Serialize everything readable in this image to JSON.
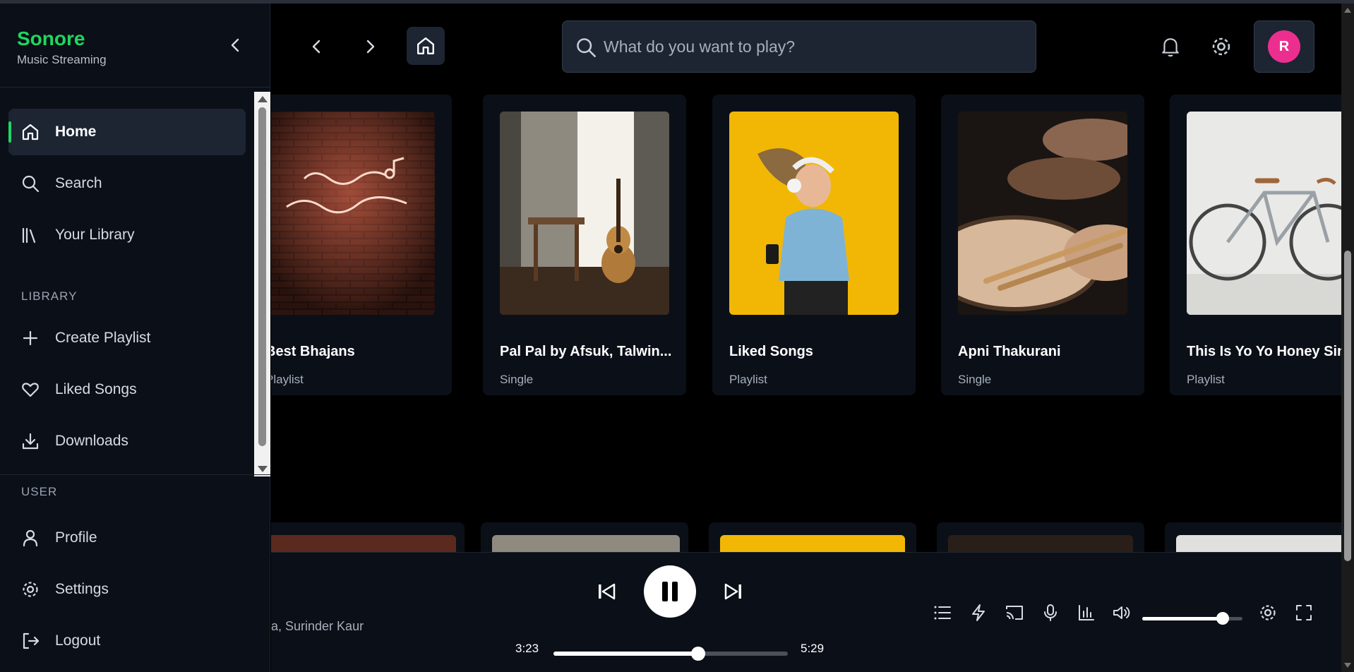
{
  "brand": {
    "name": "Sonore",
    "subtitle": "Music Streaming"
  },
  "sidebar": {
    "main_items": [
      {
        "label": "Home",
        "icon": "home-icon",
        "active": true
      },
      {
        "label": "Search",
        "icon": "search-icon"
      },
      {
        "label": "Your Library",
        "icon": "library-icon"
      }
    ],
    "library_section": "LIBRARY",
    "library_items": [
      {
        "label": "Create Playlist",
        "icon": "plus-icon"
      },
      {
        "label": "Liked Songs",
        "icon": "heart-icon"
      },
      {
        "label": "Downloads",
        "icon": "download-icon"
      }
    ],
    "user_section": "USER",
    "user_items": [
      {
        "label": "Profile",
        "icon": "user-icon"
      },
      {
        "label": "Settings",
        "icon": "gear-icon"
      },
      {
        "label": "Logout",
        "icon": "logout-icon"
      }
    ]
  },
  "search": {
    "placeholder": "What do you want to play?"
  },
  "profile": {
    "initial": "R",
    "avatar_color": "#ec2f8f"
  },
  "colors": {
    "accent": "#1ed760",
    "panel": "#1d2533",
    "background": "#000000"
  },
  "cards": [
    {
      "title": "Best Bhajans",
      "type": "Playlist",
      "art": "neon-sign-artwork"
    },
    {
      "title": "Pal Pal by Afsuk, Talwin...",
      "type": "Single",
      "art": "guitar-room-artwork"
    },
    {
      "title": "Liked Songs",
      "type": "Playlist",
      "art": "woman-headphones-artwork"
    },
    {
      "title": "Apni Thakurani",
      "type": "Single",
      "art": "drums-artwork"
    },
    {
      "title": "This Is Yo Yo Honey Singh",
      "type": "Playlist",
      "art": "bicycle-artwork"
    }
  ],
  "player": {
    "artist_fragment": "a, Surinder Kaur",
    "current_time": "3:23",
    "total_time": "5:29",
    "progress_fraction": 0.616,
    "volume_fraction": 0.8,
    "state": "playing"
  }
}
